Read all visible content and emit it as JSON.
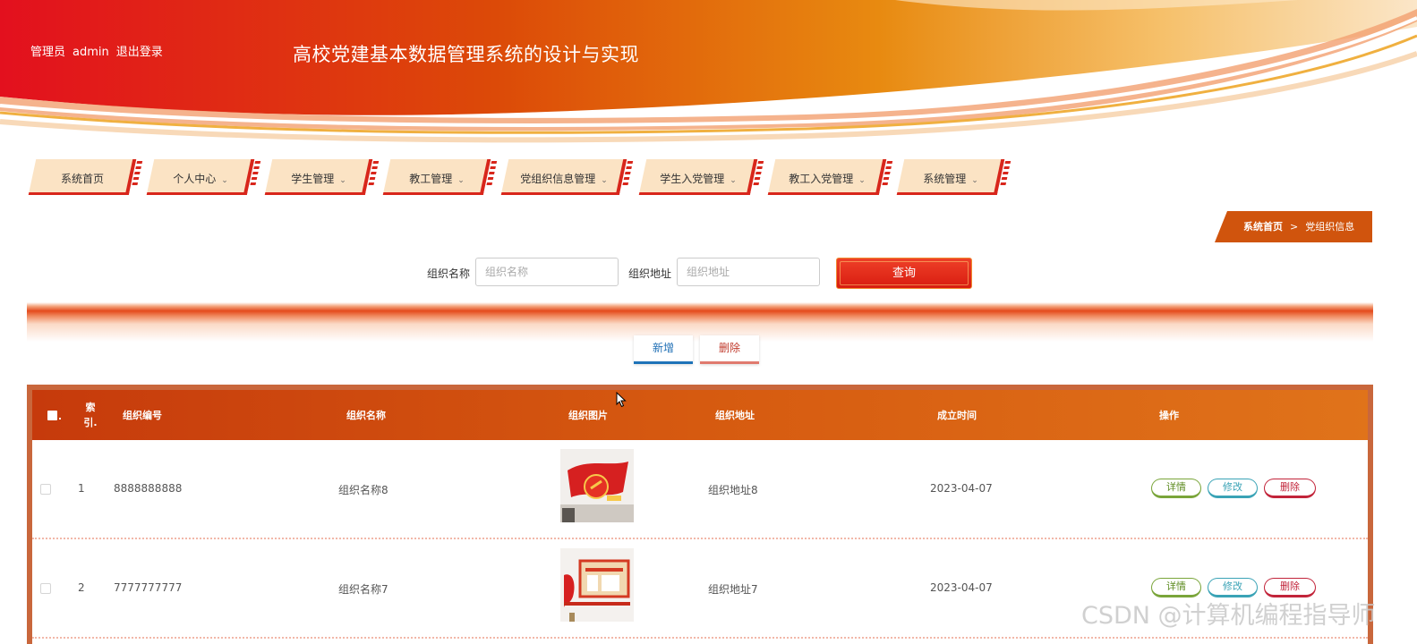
{
  "header": {
    "role_label": "管理员",
    "username": "admin",
    "logout_label": "退出登录",
    "site_title": "高校党建基本数据管理系统的设计与实现"
  },
  "nav": {
    "items": [
      {
        "label": "系统首页",
        "has_dropdown": false
      },
      {
        "label": "个人中心",
        "has_dropdown": true
      },
      {
        "label": "学生管理",
        "has_dropdown": true
      },
      {
        "label": "教工管理",
        "has_dropdown": true
      },
      {
        "label": "党组织信息管理",
        "has_dropdown": true
      },
      {
        "label": "学生入党管理",
        "has_dropdown": true
      },
      {
        "label": "教工入党管理",
        "has_dropdown": true
      },
      {
        "label": "系统管理",
        "has_dropdown": true
      }
    ],
    "chevron": "⌄"
  },
  "breadcrumb": {
    "home": "系统首页",
    "separator": ">",
    "current": "党组织信息"
  },
  "search": {
    "name_label": "组织名称",
    "name_placeholder": "组织名称",
    "address_label": "组织地址",
    "address_placeholder": "组织地址",
    "query_label": "查询"
  },
  "actions": {
    "add_label": "新增",
    "delete_label": "删除"
  },
  "table": {
    "headers": {
      "index": "索引.",
      "code": "组织编号",
      "name": "组织名称",
      "image": "组织图片",
      "address": "组织地址",
      "founded": "成立时间",
      "ops": "操作"
    },
    "rows": [
      {
        "index": "1",
        "code": "8888888888",
        "name": "组织名称8",
        "address": "组织地址8",
        "founded": "2023-04-07"
      },
      {
        "index": "2",
        "code": "7777777777",
        "name": "组织名称7",
        "address": "组织地址7",
        "founded": "2023-04-07"
      }
    ],
    "op_labels": {
      "detail": "详情",
      "edit": "修改",
      "delete": "删除"
    }
  },
  "watermark": "CSDN @计算机编程指导师",
  "colors": {
    "brand_red": "#d8261b",
    "brand_orange": "#e0731a",
    "nav_bg": "#fbe3c4",
    "breadcrumb_bg": "#d0540d"
  }
}
